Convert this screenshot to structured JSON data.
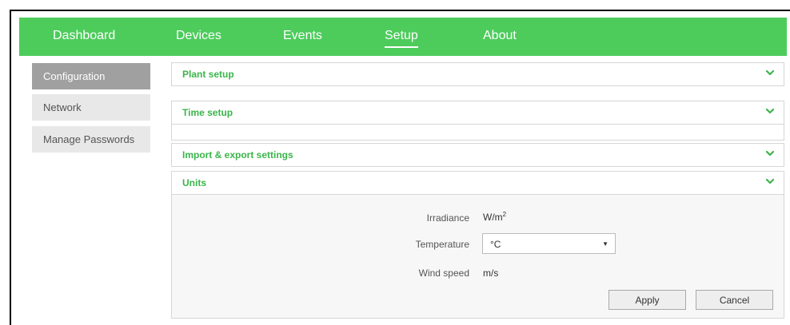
{
  "nav": {
    "items": [
      "Dashboard",
      "Devices",
      "Events",
      "Setup",
      "About"
    ],
    "active": "Setup"
  },
  "sidebar": {
    "items": [
      "Configuration",
      "Network",
      "Manage Passwords"
    ],
    "active": "Configuration"
  },
  "panels": {
    "plant_setup": "Plant setup",
    "time_setup": "Time setup",
    "import_export": "Import & export settings",
    "units": "Units"
  },
  "units": {
    "irradiance_label": "Irradiance",
    "irradiance_value": "W/m",
    "irradiance_exponent": "2",
    "temperature_label": "Temperature",
    "temperature_value": "°C",
    "wind_speed_label": "Wind speed",
    "wind_speed_value": "m/s",
    "apply_label": "Apply",
    "cancel_label": "Cancel"
  },
  "colors": {
    "brand_green": "#4dcc5c",
    "panel_title_green": "#3ab54a"
  },
  "icons": {
    "panel_toggle": "chevron-down-icon",
    "select_arrow": "caret-down-icon"
  }
}
